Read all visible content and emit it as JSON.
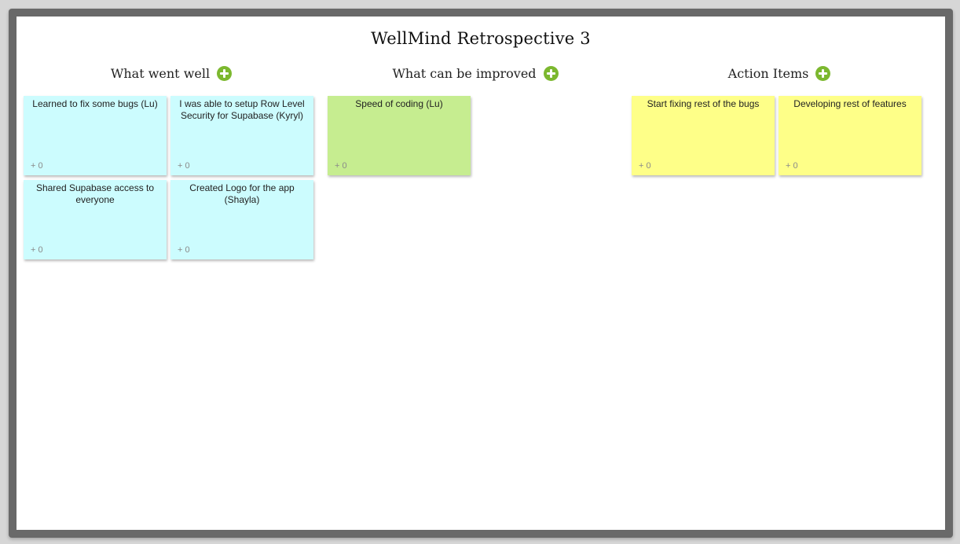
{
  "board": {
    "title": "WellMind Retrospective 3"
  },
  "colors": {
    "went_well": "#ccfcfe",
    "improve": "#c6ed90",
    "action": "#feff88",
    "add_button": "#7cb82f",
    "frame": "#696969"
  },
  "columns": [
    {
      "title": "What went well",
      "add_icon": "plus-circle-icon",
      "notes": [
        {
          "text": "Learned to fix some bugs (Lu)",
          "votes": "+ 0"
        },
        {
          "text": "I was able to setup Row Level Security for Supabase (Kyryl)",
          "votes": "+ 0"
        },
        {
          "text": "Shared Supabase access to everyone",
          "votes": "+ 0"
        },
        {
          "text": "Created Logo for the app (Shayla)",
          "votes": "+ 0"
        }
      ]
    },
    {
      "title": "What can be improved",
      "add_icon": "plus-circle-icon",
      "notes": [
        {
          "text": "Speed of coding (Lu)",
          "votes": "+ 0"
        }
      ]
    },
    {
      "title": "Action Items",
      "add_icon": "plus-circle-icon",
      "notes": [
        {
          "text": "Start fixing rest of the bugs",
          "votes": "+ 0"
        },
        {
          "text": "Developing rest of features",
          "votes": "+ 0"
        }
      ]
    }
  ]
}
